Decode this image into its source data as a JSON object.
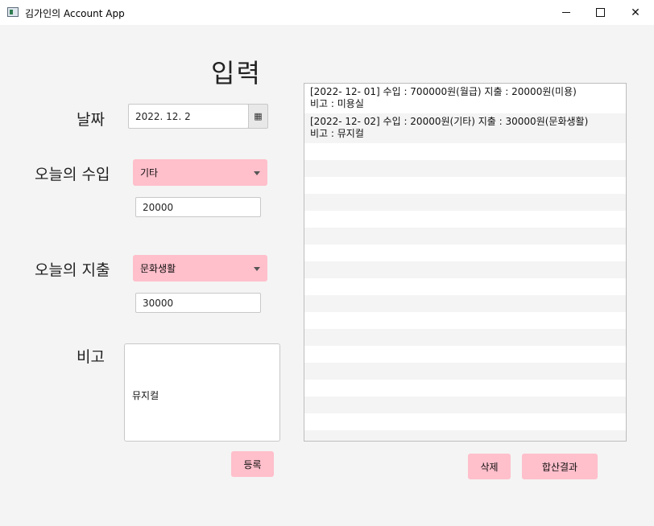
{
  "window": {
    "title": "김가인의 Account App",
    "icon": "app-window-icon",
    "controls": {
      "minimize": "─",
      "maximize": "□",
      "close": "✕"
    }
  },
  "form": {
    "heading": "입력",
    "date_label": "날짜",
    "date_value": "2022. 12. 2",
    "calendar_icon": "▦",
    "income_label": "오늘의 수입",
    "income_category": "기타",
    "income_amount": "20000",
    "expense_label": "오늘의 지출",
    "expense_category": "문화생활",
    "expense_amount": "30000",
    "memo_label": "비고",
    "memo_value": "뮤지컬",
    "register_button": "등록"
  },
  "records": {
    "items": [
      {
        "line1": "[2022- 12- 01] 수입 : 700000원(월급)  지출 : 20000원(미용)",
        "line2": "비고 : 미용실"
      },
      {
        "line1": "[2022- 12- 02] 수입 : 20000원(기타)  지출 : 30000원(문화생활)",
        "line2": "비고 : 뮤지컬"
      }
    ],
    "delete_button": "삭제",
    "total_button": "합산결과"
  },
  "colors": {
    "accent_pink": "#ffbfcb",
    "background": "#f4f4f4"
  }
}
